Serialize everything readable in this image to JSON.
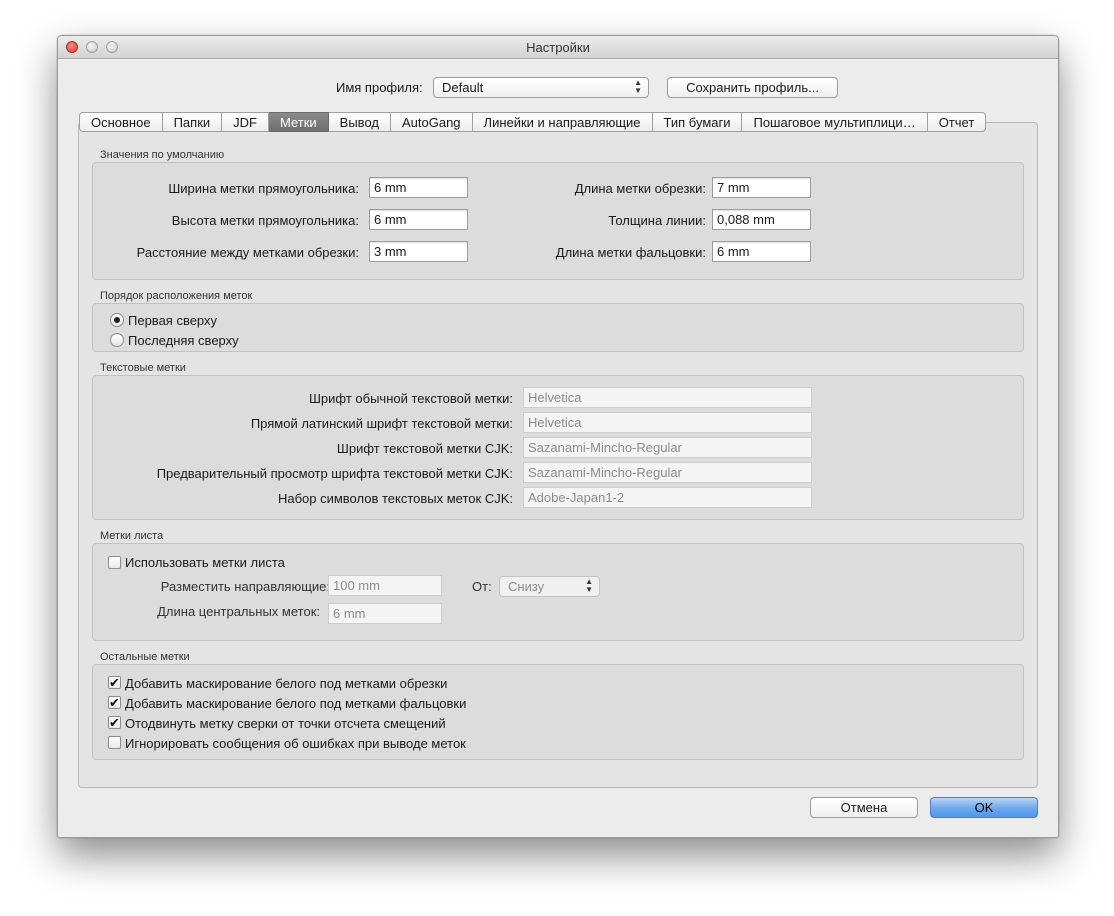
{
  "window": {
    "title": "Настройки"
  },
  "profile": {
    "label": "Имя профиля:",
    "value": "Default",
    "save_button": "Сохранить профиль..."
  },
  "tabs": [
    "Основное",
    "Папки",
    "JDF",
    "Метки",
    "Вывод",
    "AutoGang",
    "Линейки и направляющие",
    "Тип бумаги",
    "Пошаговое мультиплици…",
    "Отчет"
  ],
  "active_tab": "Метки",
  "defaults": {
    "title": "Значения по умолчанию",
    "rect_width_label": "Ширина метки прямоугольника:",
    "rect_width_value": "6 mm",
    "rect_height_label": "Высота метки прямоугольника:",
    "rect_height_value": "6 mm",
    "crop_spacing_label": "Расстояние между метками обрезки:",
    "crop_spacing_value": "3 mm",
    "crop_length_label": "Длина метки обрезки:",
    "crop_length_value": "7 mm",
    "line_thickness_label": "Толщина линии:",
    "line_thickness_value": "0,088 mm",
    "fold_length_label": "Длина метки фальцовки:",
    "fold_length_value": "6 mm"
  },
  "order": {
    "title": "Порядок расположения меток",
    "first_on_top": "Первая сверху",
    "last_on_top": "Последняя сверху",
    "selected": "first_on_top"
  },
  "text_marks": {
    "title": "Текстовые метки",
    "font_label": "Шрифт обычной текстовой метки:",
    "font_value": "Helvetica",
    "roman_font_label": "Прямой латинский шрифт текстовой метки:",
    "roman_font_value": "Helvetica",
    "cjk_font_label": "Шрифт текстовой метки CJK:",
    "cjk_font_value": "Sazanami-Mincho-Regular",
    "cjk_preview_label": "Предварительный просмотр шрифта текстовой метки CJK:",
    "cjk_preview_value": "Sazanami-Mincho-Regular",
    "cjk_charset_label": "Набор символов текстовых меток CJK:",
    "cjk_charset_value": "Adobe-Japan1-2"
  },
  "sheet_marks": {
    "title": "Метки листа",
    "use_label": "Использовать метки листа",
    "use_checked": false,
    "place_guides_label": "Разместить направляющие:",
    "place_guides_value": "100 mm",
    "from_label": "От:",
    "from_value": "Снизу",
    "center_length_label": "Длина центральных меток:",
    "center_length_value": "6 mm"
  },
  "other_marks": {
    "title": "Остальные метки",
    "items": [
      {
        "label": "Добавить маскирование белого под метками обрезки",
        "checked": true
      },
      {
        "label": "Добавить маскирование белого под метками фальцовки",
        "checked": true
      },
      {
        "label": "Отодвинуть метку сверки от точки отсчета смещений",
        "checked": true
      },
      {
        "label": "Игнорировать сообщения об ошибках при выводе меток",
        "checked": false
      }
    ]
  },
  "buttons": {
    "cancel": "Отмена",
    "ok": "OK"
  },
  "check_glyph": "✔"
}
